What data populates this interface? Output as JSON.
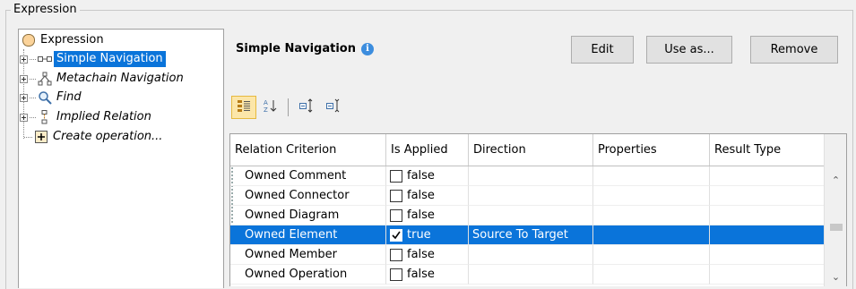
{
  "group": {
    "title": "Expression"
  },
  "tree": {
    "items": [
      {
        "label": "Expression",
        "icon": "expression-icon"
      },
      {
        "label": "Simple Navigation",
        "icon": "simple-navigation-icon",
        "selected": true
      },
      {
        "label": "Metachain Navigation",
        "icon": "metachain-icon"
      },
      {
        "label": "Find",
        "icon": "find-icon"
      },
      {
        "label": "Implied Relation",
        "icon": "implied-relation-icon"
      },
      {
        "label": "Create operation...",
        "icon": "add-icon"
      }
    ]
  },
  "header": {
    "title": "Simple Navigation",
    "info_icon": "i",
    "buttons": {
      "edit": "Edit",
      "use_as": "Use as...",
      "remove": "Remove"
    }
  },
  "toolbar": {
    "icons": [
      "categorized-icon",
      "sort-az-icon",
      "expand-all-icon",
      "collapse-all-icon"
    ]
  },
  "table": {
    "columns": [
      "Relation Criterion",
      "Is Applied",
      "Direction",
      "Properties",
      "Result Type"
    ],
    "rows": [
      {
        "criterion": "Owned Comment",
        "applied": false,
        "applied_text": "false",
        "direction": "",
        "properties": "",
        "result_type": ""
      },
      {
        "criterion": "Owned Connector",
        "applied": false,
        "applied_text": "false",
        "direction": "",
        "properties": "",
        "result_type": ""
      },
      {
        "criterion": "Owned Diagram",
        "applied": false,
        "applied_text": "false",
        "direction": "",
        "properties": "",
        "result_type": ""
      },
      {
        "criterion": "Owned Element",
        "applied": true,
        "applied_text": "true",
        "direction": "Source To Target",
        "properties": "",
        "result_type": "",
        "selected": true
      },
      {
        "criterion": "Owned Member",
        "applied": false,
        "applied_text": "false",
        "direction": "",
        "properties": "",
        "result_type": ""
      },
      {
        "criterion": "Owned Operation",
        "applied": false,
        "applied_text": "false",
        "direction": "",
        "properties": "",
        "result_type": ""
      }
    ]
  },
  "colors": {
    "selection": "#0a74da",
    "toolbar_active": "#fce6a9"
  }
}
